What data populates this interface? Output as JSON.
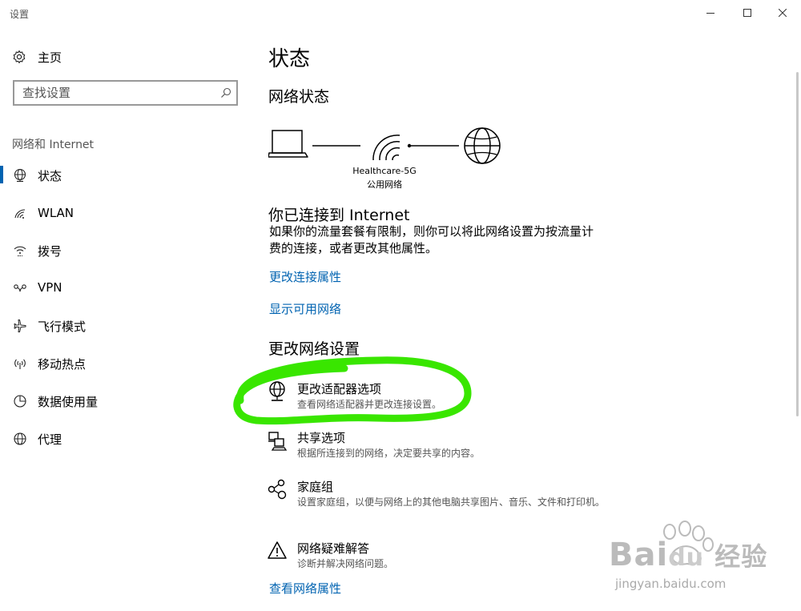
{
  "window": {
    "title": "设置"
  },
  "sidebar": {
    "home_label": "主页",
    "search_placeholder": "查找设置",
    "section_title": "网络和 Internet",
    "items": [
      {
        "label": "状态",
        "icon": "globe-status-icon",
        "active": true
      },
      {
        "label": "WLAN",
        "icon": "wifi-icon"
      },
      {
        "label": "拨号",
        "icon": "dialup-icon"
      },
      {
        "label": "VPN",
        "icon": "vpn-icon"
      },
      {
        "label": "飞行模式",
        "icon": "airplane-icon"
      },
      {
        "label": "移动热点",
        "icon": "hotspot-icon"
      },
      {
        "label": "数据使用量",
        "icon": "data-usage-icon"
      },
      {
        "label": "代理",
        "icon": "globe-icon"
      }
    ]
  },
  "main": {
    "page_title": "状态",
    "network_status_heading": "网络状态",
    "network": {
      "name": "Healthcare-5G",
      "type": "公用网络"
    },
    "connected_heading": "你已连接到 Internet",
    "connected_desc": "如果你的流量套餐有限制，则你可以将此网络设置为按流量计费的连接，或者更改其他属性。",
    "links": {
      "change_properties": "更改连接属性",
      "show_networks": "显示可用网络",
      "view_properties": "查看网络属性"
    },
    "change_heading": "更改网络设置",
    "options": [
      {
        "title": "更改适配器选项",
        "desc": "查看网络适配器并更改连接设置。"
      },
      {
        "title": "共享选项",
        "desc": "根据所连接到的网络，决定要共享的内容。"
      },
      {
        "title": "家庭组",
        "desc": "设置家庭组，以便与网络上的其他电脑共享图片、音乐、文件和打印机。"
      },
      {
        "title": "网络疑难解答",
        "desc": "诊断并解决网络问题。"
      }
    ]
  },
  "watermark": {
    "brand": "Bai",
    "brand2": "du",
    "cn": "经验",
    "url": "jingyan.baidu.com"
  },
  "colors": {
    "accent": "#0063b1",
    "highlight": "#39e600"
  }
}
